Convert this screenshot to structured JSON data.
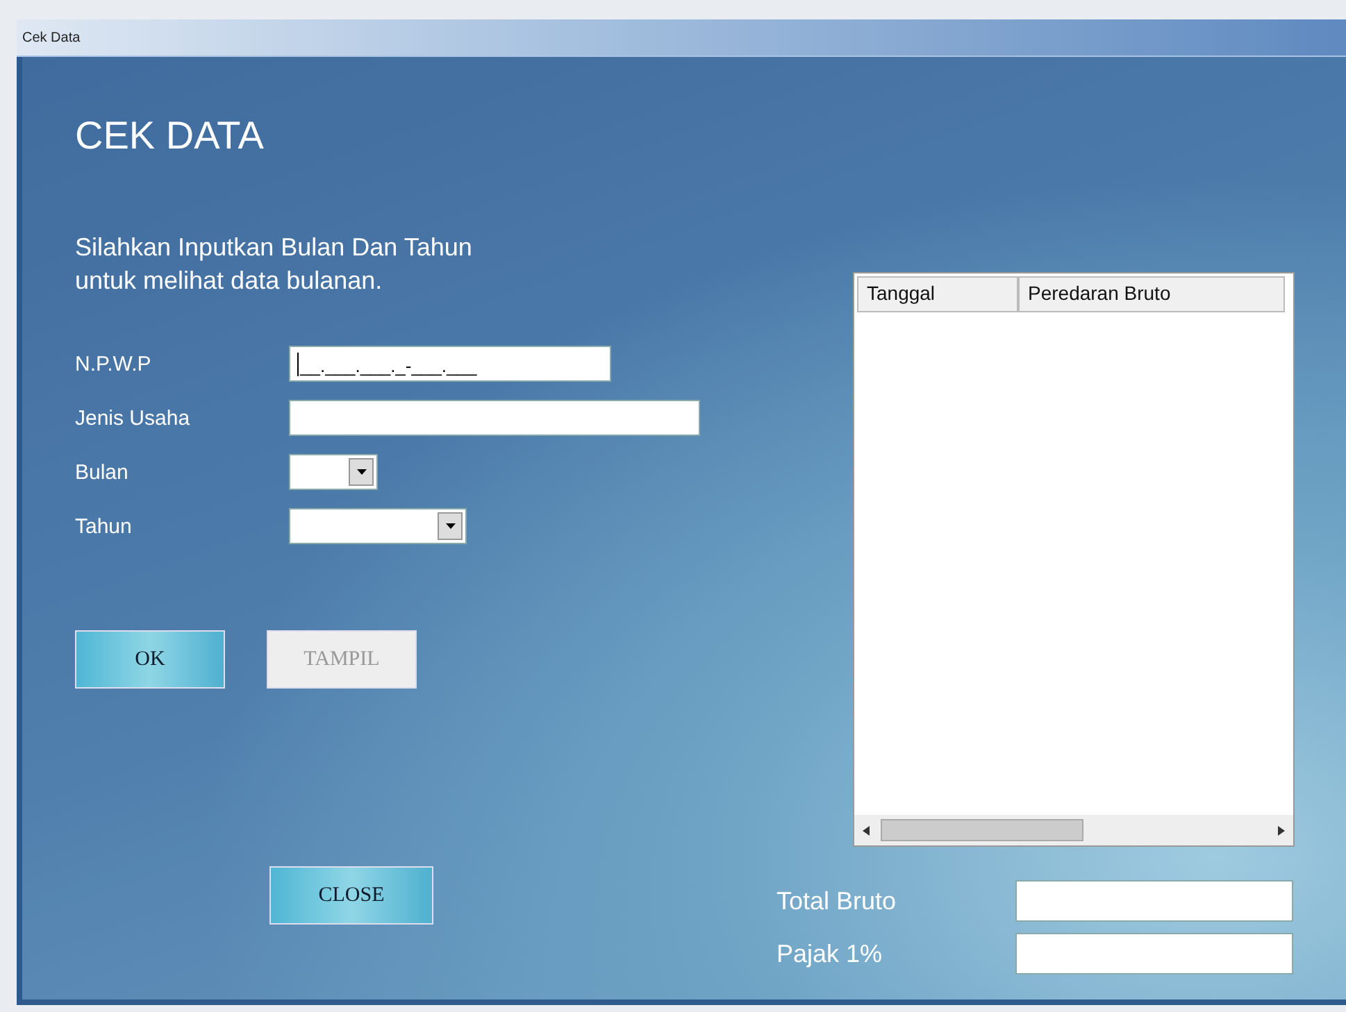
{
  "window": {
    "title": "Cek Data"
  },
  "heading": "CEK DATA",
  "instruction": [
    "Silahkan Inputkan Bulan Dan Tahun",
    "untuk melihat data bulanan."
  ],
  "fields": [
    {
      "label": "N.P.W.P",
      "kind": "masked",
      "value": "__.___.___._-___.___"
    },
    {
      "label": "Jenis Usaha",
      "kind": "text"
    },
    {
      "label": "Bulan",
      "kind": "combo"
    },
    {
      "label": "Tahun",
      "kind": "combo"
    }
  ],
  "buttons": [
    {
      "label": "OK",
      "disabled": false
    },
    {
      "label": "TAMPIL",
      "disabled": true
    }
  ],
  "close_button": {
    "label": "CLOSE",
    "disabled": false
  },
  "table": {
    "columns": [
      "Tanggal",
      "Peredaran Bruto"
    ]
  },
  "totals": [
    {
      "label": "Total Bruto"
    },
    {
      "label": "Pajak 1%"
    }
  ]
}
